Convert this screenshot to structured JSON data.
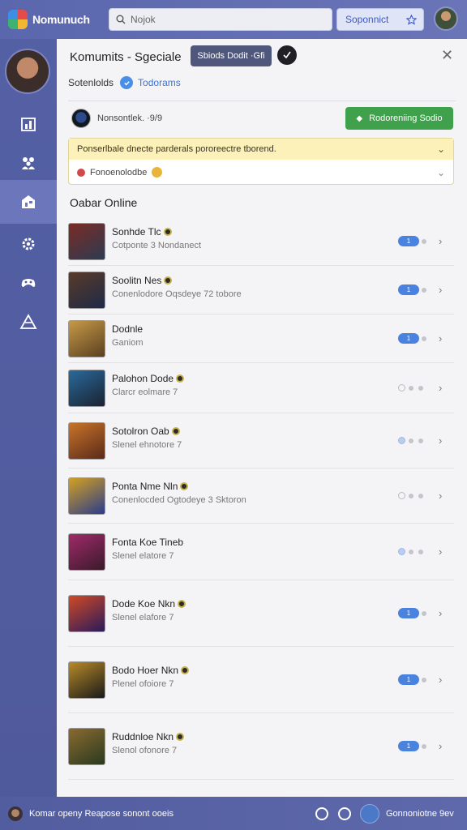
{
  "app": {
    "name": "Nomunuch"
  },
  "search": {
    "placeholder": "Nojok"
  },
  "top_button": {
    "label": "Soponnict"
  },
  "panel": {
    "title": "Komumits - Sgeciale",
    "pill_label": "Sbiods Dodit ·Gfi",
    "subtitle": "Sotenlolds",
    "sublink": "Todorams",
    "member_text": "Nonsontlek. ·9/9",
    "green_button": "Rodoreniing Sodio",
    "notice_top": "Ponserlbale dnecte parderals pororeectre tborend.",
    "notice_bottom": "Fonoenolodbe",
    "section_title": "Oabar Online"
  },
  "list": [
    {
      "name": "Sonhde Tlc",
      "sub": "Cotponte 3 Nondanect",
      "status": "pill",
      "count": "1",
      "badge": true,
      "colors": [
        "#7a2b24",
        "#2c3b52"
      ]
    },
    {
      "name": "Soolitn Nes",
      "sub": "Conenlodore Oqsdeye 72 tobore",
      "status": "pill",
      "count": "1",
      "badge": true,
      "colors": [
        "#5a3a28",
        "#1e2a48"
      ]
    },
    {
      "name": "Dodnle",
      "sub": "Ganiom",
      "status": "pill",
      "count": "1",
      "badge": false,
      "colors": [
        "#c79a48",
        "#5a4020"
      ]
    },
    {
      "name": "Palohon Dode",
      "sub": "Clarcr eolmare 7",
      "status": "dots",
      "count": "",
      "badge": true,
      "colors": [
        "#2a6a9c",
        "#1a2230"
      ]
    },
    {
      "name": "Sotolron Oab",
      "sub": "Slenel ehnotore 7",
      "status": "bluedots",
      "count": "",
      "badge": true,
      "colors": [
        "#c8742a",
        "#5a2a18"
      ]
    },
    {
      "name": "Ponta Nme Nln",
      "sub": "Conenlocded Ogtodeye 3 Sktoron",
      "status": "dots",
      "count": "",
      "badge": true,
      "colors": [
        "#d4a020",
        "#2a3c8c"
      ]
    },
    {
      "name": "Fonta Koe Tineb",
      "sub": "Slenel elatore 7",
      "status": "bluedots",
      "count": "",
      "badge": false,
      "colors": [
        "#a02a6a",
        "#3a1a2a"
      ]
    },
    {
      "name": "Dode Koe Nkn",
      "sub": "Slenel elafore 7",
      "status": "pill",
      "count": "1",
      "badge": true,
      "colors": [
        "#d04a24",
        "#2a1a5c"
      ]
    },
    {
      "name": "Bodo Hoer Nkn",
      "sub": "Plenel ofoiore 7",
      "status": "pill",
      "count": "1",
      "badge": true,
      "colors": [
        "#b88a28",
        "#1a1a1a"
      ]
    },
    {
      "name": "Ruddnloe Nkn",
      "sub": "Slenol ofonore 7",
      "status": "pill",
      "count": "1",
      "badge": true,
      "colors": [
        "#8a6a30",
        "#2a3a20"
      ]
    }
  ],
  "bottom_bar": {
    "left_text": "Komar openy Reapose sonont ooeis",
    "right_text": "Gonnoniotne 9ev"
  }
}
